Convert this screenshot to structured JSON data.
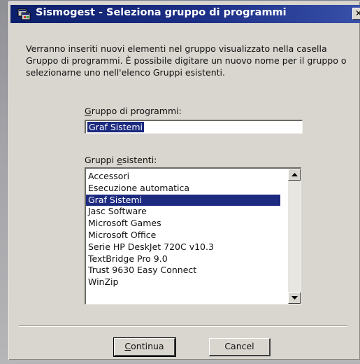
{
  "window": {
    "title": "Sismogest - Seleziona gruppo di programmi",
    "close_glyph": "✕",
    "title_icon": "program-group-icon",
    "close_icon": "close-icon"
  },
  "instructions": "Verranno inseriti nuovi elementi nel gruppo visualizzato nella casella Gruppo di programmi. È possibile digitare un nuovo nome per il gruppo o selezionarne uno nell'elenco Gruppi esistenti.",
  "group_field": {
    "label_accel": "G",
    "label_rest": "ruppo di programmi:",
    "value": "Graf Sistemi"
  },
  "existing_groups": {
    "label_pre": "Gruppi ",
    "label_accel": "e",
    "label_post": "sistenti:",
    "items": [
      "Accessori",
      "Esecuzione automatica",
      "Graf Sistemi",
      "Jasc Software",
      "Microsoft Games",
      "Microsoft Office",
      "Serie HP DeskJet 720C v10.3",
      "TextBridge Pro 9.0",
      "Trust 9630 Easy Connect",
      "WinZip"
    ],
    "selected": "Graf Sistemi"
  },
  "buttons": {
    "continue_accel": "C",
    "continue_rest": "ontinua",
    "cancel": "Cancel"
  },
  "colors": {
    "title_bar": "#1c2f86",
    "selection": "#1c2a80",
    "dialog_face": "#d9d6cf"
  }
}
